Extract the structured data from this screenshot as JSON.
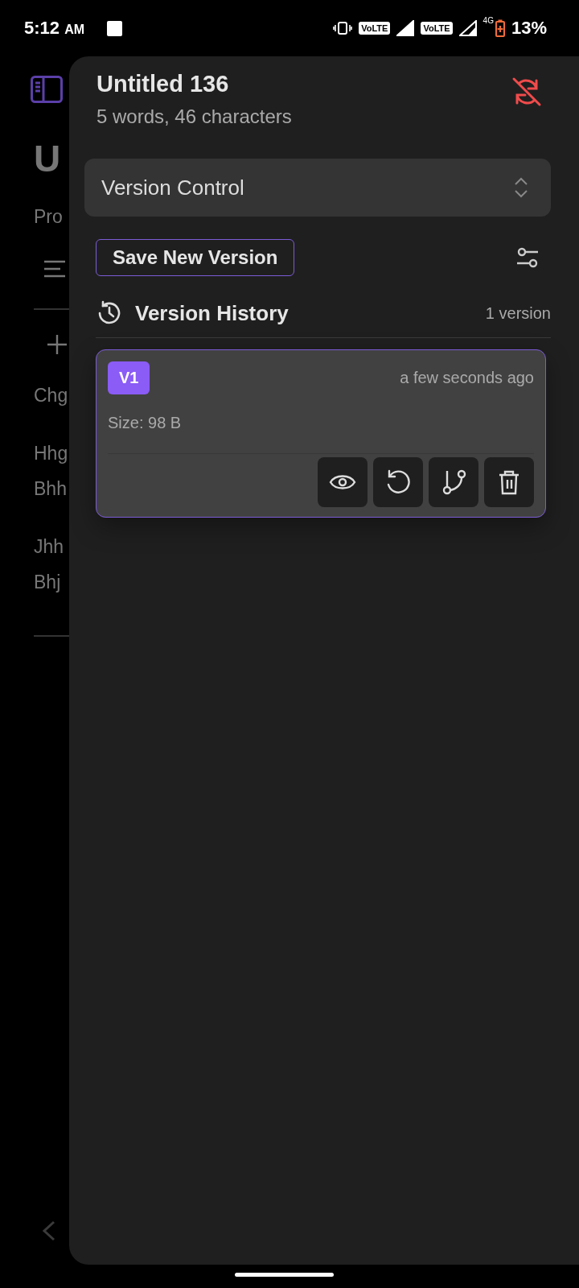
{
  "status_bar": {
    "time": "5:12",
    "meridiem": "AM",
    "volte_badges": [
      "VoLTE",
      "VoLTE"
    ],
    "network": "4G",
    "battery": "13%"
  },
  "background_page": {
    "title": "U",
    "subtitle": "Pro",
    "paragraphs": [
      [
        "Chg"
      ],
      [
        "Hhg",
        "Bhh"
      ],
      [
        "Jhh",
        "Bhj"
      ]
    ]
  },
  "panel": {
    "title": "Untitled 136",
    "stats": "5 words, 46 characters",
    "sync_enabled": false,
    "mode_select": {
      "value": "Version Control"
    },
    "save_button": "Save New Version",
    "history": {
      "title": "Version History",
      "count": "1 version",
      "versions": [
        {
          "badge": "V1",
          "time": "a few seconds ago",
          "size": "Size: 98 B",
          "selected": true,
          "actions": [
            {
              "kind": "view"
            },
            {
              "kind": "restore"
            },
            {
              "kind": "branch"
            },
            {
              "kind": "delete"
            }
          ]
        }
      ]
    }
  }
}
